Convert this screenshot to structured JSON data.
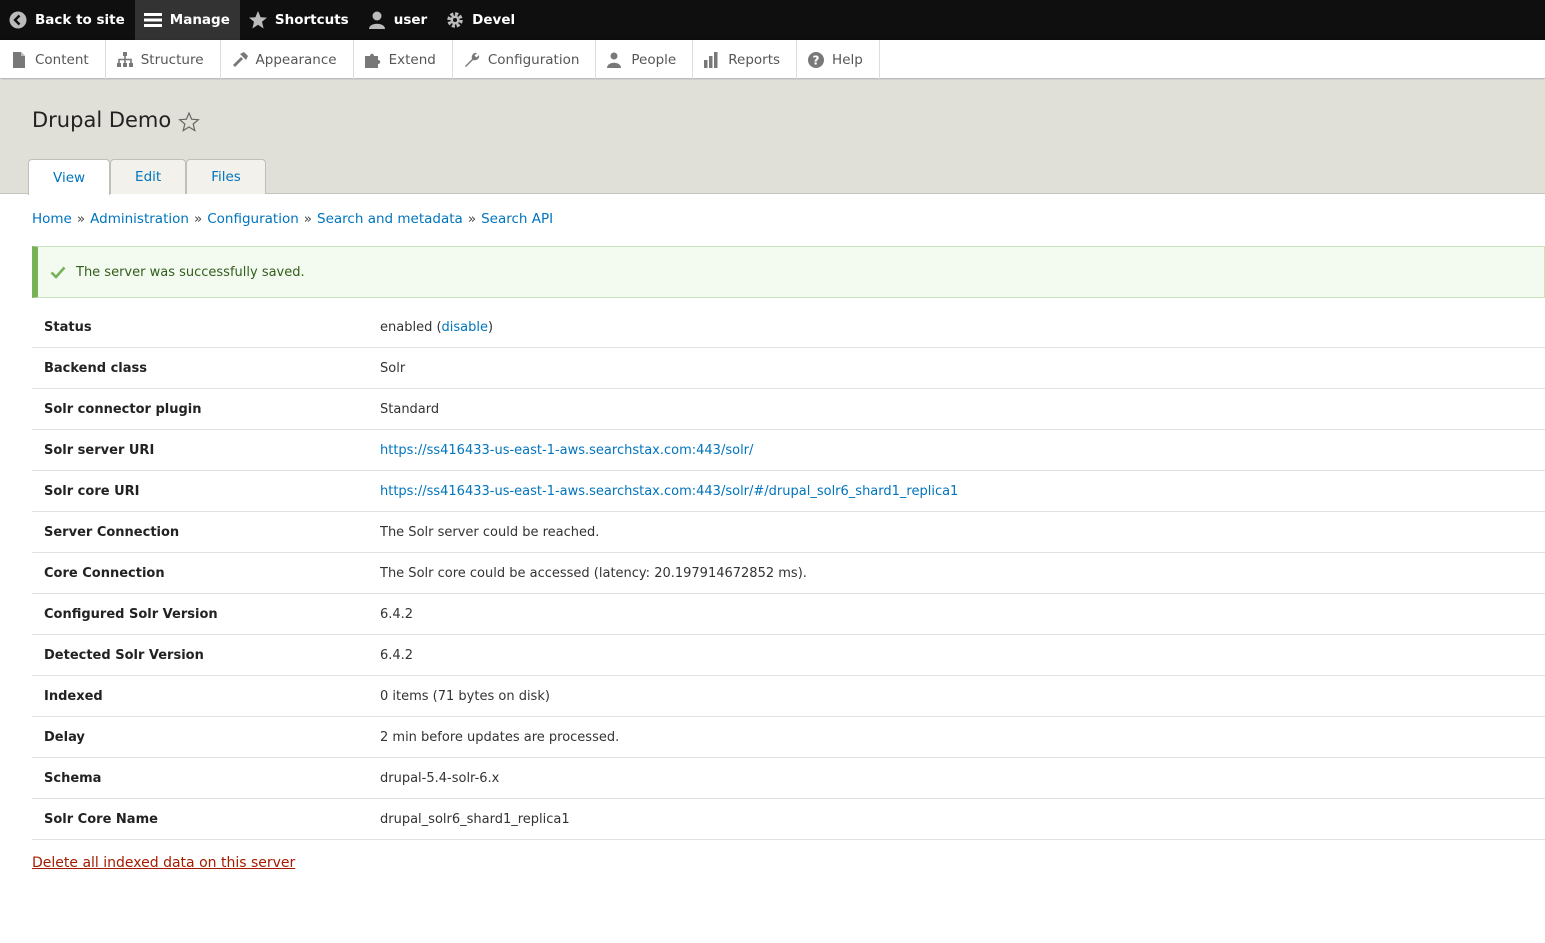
{
  "toolbar": {
    "items": [
      {
        "label": "Back to site",
        "icon": "back-arrow-icon"
      },
      {
        "label": "Manage",
        "icon": "hamburger-menu-icon",
        "active": true
      },
      {
        "label": "Shortcuts",
        "icon": "star-icon"
      },
      {
        "label": "user",
        "icon": "person-icon"
      },
      {
        "label": "Devel",
        "icon": "gear-icon"
      }
    ]
  },
  "tray": {
    "items": [
      {
        "label": "Content",
        "icon": "document-icon"
      },
      {
        "label": "Structure",
        "icon": "sitemap-icon"
      },
      {
        "label": "Appearance",
        "icon": "paintbrush-icon"
      },
      {
        "label": "Extend",
        "icon": "puzzle-icon"
      },
      {
        "label": "Configuration",
        "icon": "wrench-icon"
      },
      {
        "label": "People",
        "icon": "people-icon"
      },
      {
        "label": "Reports",
        "icon": "bar-chart-icon"
      },
      {
        "label": "Help",
        "icon": "question-icon"
      }
    ]
  },
  "header": {
    "title": "Drupal Demo",
    "tabs": [
      {
        "label": "View",
        "active": true
      },
      {
        "label": "Edit"
      },
      {
        "label": "Files"
      }
    ]
  },
  "breadcrumb": [
    "Home",
    "Administration",
    "Configuration",
    "Search and metadata",
    "Search API"
  ],
  "breadcrumb_separator": "»",
  "message": "The server was successfully saved.",
  "status_row": {
    "label": "Status",
    "text": "enabled",
    "open": "(",
    "link": "disable",
    "close": ")"
  },
  "rows": [
    {
      "label": "Backend class",
      "value": "Solr"
    },
    {
      "label": "Solr connector plugin",
      "value": "Standard"
    },
    {
      "label": "Solr server URI",
      "value": "https://ss416433-us-east-1-aws.searchstax.com:443/solr/",
      "link": true
    },
    {
      "label": "Solr core URI",
      "value": "https://ss416433-us-east-1-aws.searchstax.com:443/solr/#/drupal_solr6_shard1_replica1",
      "link": true
    },
    {
      "label": "Server Connection",
      "value": "The Solr server could be reached."
    },
    {
      "label": "Core Connection",
      "value": "The Solr core could be accessed (latency: 20.197914672852 ms)."
    },
    {
      "label": "Configured Solr Version",
      "value": "6.4.2"
    },
    {
      "label": "Detected Solr Version",
      "value": "6.4.2"
    },
    {
      "label": "Indexed",
      "value": "0 items (71 bytes on disk)"
    },
    {
      "label": "Delay",
      "value": "2 min before updates are processed."
    },
    {
      "label": "Schema",
      "value": "drupal-5.4-solr-6.x"
    },
    {
      "label": "Solr Core Name",
      "value": "drupal_solr6_shard1_replica1"
    }
  ],
  "delete_link": "Delete all indexed data on this server",
  "colors": {
    "toolbar_bg": "#0f0f0f",
    "link": "#0074bd",
    "success_border": "#77b259",
    "danger_link": "#a51b00"
  }
}
